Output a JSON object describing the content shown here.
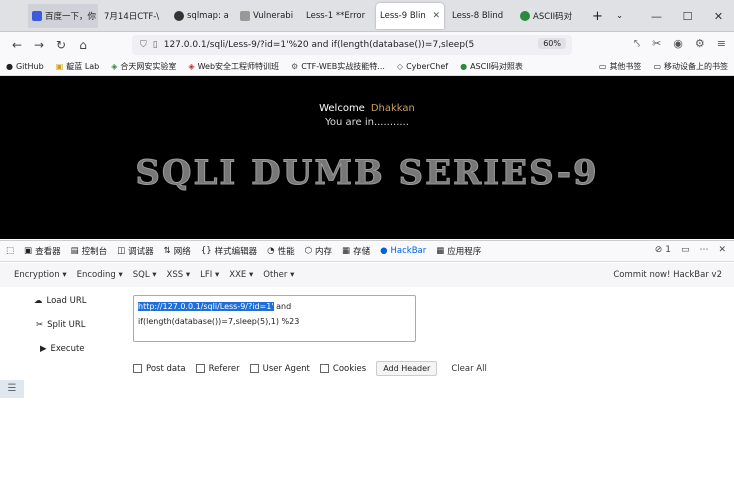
{
  "tabs": [
    {
      "label": "百度一下，你",
      "color": "#3b5bdb",
      "active": false
    },
    {
      "label": "7月14日CTF-\\",
      "color": "#777",
      "active": false
    },
    {
      "label": "sqlmap: a",
      "color": "#333",
      "active": false
    },
    {
      "label": "Vulnerabi",
      "color": "#444",
      "active": false
    },
    {
      "label": "Less-1 **Error",
      "color": "#555",
      "active": false
    },
    {
      "label": "Less-9 Blin",
      "color": "#666",
      "active": true
    },
    {
      "label": "Less-8 Blind",
      "color": "#666",
      "active": false
    },
    {
      "label": "ASCII码对",
      "color": "#2b8a3e",
      "active": false
    }
  ],
  "url": "127.0.0.1/sqli/Less-9/?id=1'%20 and if(length(database())=7,sleep(5",
  "zoom": "60%",
  "bookmarks": [
    "GitHub",
    "靛蓝 Lab",
    "合天网安实验室",
    "Web安全工程师特训班",
    "CTF-WEB实战技能特...",
    "CyberChef",
    "ASCII码对照表"
  ],
  "bookmarks_right": [
    "其他书签",
    "移动设备上的书签"
  ],
  "page": {
    "welcome": "Welcome",
    "name": "Dhakkan",
    "youare": "You are in...........",
    "title": "SQLI DUMB SERIES-9"
  },
  "devtools": [
    "查看器",
    "控制台",
    "调试器",
    "网络",
    "样式编辑器",
    "性能",
    "内存",
    "存储",
    "HackBar",
    "应用程序"
  ],
  "devtools_count": "1",
  "hackbar_menu": [
    "Encryption",
    "Encoding",
    "SQL",
    "XSS",
    "LFI",
    "XXE",
    "Other"
  ],
  "commit": "Commit now! HackBar v2",
  "actions": {
    "load": "Load URL",
    "split": "Split URL",
    "execute": "Execute"
  },
  "textarea": {
    "line1_hl": "http://127.0.0.1/sqli/Less-9/?id=1'",
    "line1_rest": "  and",
    "line2": "if(length(database())=7,sleep(5),1) %23"
  },
  "options": {
    "post": "Post data",
    "referer": "Referer",
    "ua": "User Agent",
    "cookies": "Cookies",
    "addheader": "Add Header",
    "clear": "Clear All"
  }
}
